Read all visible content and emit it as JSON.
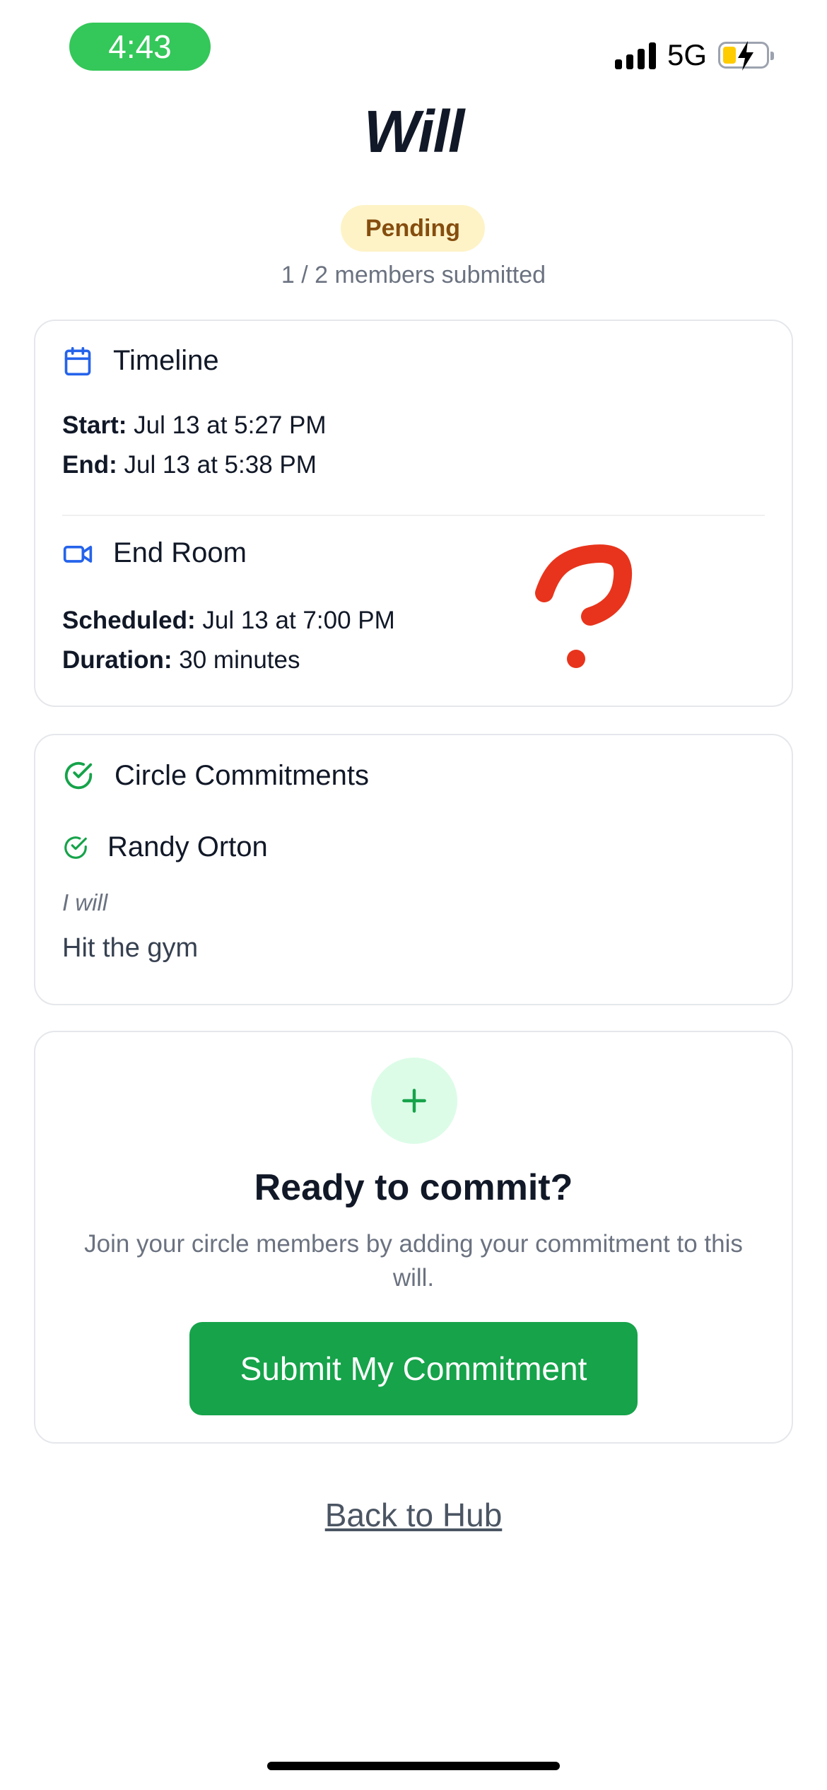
{
  "status_bar": {
    "time": "4:43",
    "network": "5G"
  },
  "page": {
    "title": "Will",
    "status_badge": "Pending",
    "members_submitted": "1 / 2 members submitted"
  },
  "timeline": {
    "heading": "Timeline",
    "start_label": "Start:",
    "start_value": "Jul 13 at 5:27 PM",
    "end_label": "End:",
    "end_value": "Jul 13 at 5:38 PM"
  },
  "end_room": {
    "heading": "End Room",
    "scheduled_label": "Scheduled:",
    "scheduled_value": "Jul 13 at 7:00 PM",
    "duration_label": "Duration:",
    "duration_value": "30 minutes"
  },
  "commitments": {
    "heading": "Circle Commitments",
    "items": [
      {
        "member": "Randy Orton",
        "prefix": "I will",
        "text": "Hit the gym"
      }
    ]
  },
  "cta": {
    "heading": "Ready to commit?",
    "description": "Join your circle members by adding your commitment to this will.",
    "button_label": "Submit My Commitment"
  },
  "footer": {
    "back_link": "Back to Hub"
  },
  "colors": {
    "accent_green": "#16a34a",
    "pending_bg": "#fef3c7",
    "pending_text": "#854d0e",
    "icon_blue": "#2563eb",
    "annotation_red": "#e8341c"
  },
  "icons": {
    "timeline": "calendar-icon",
    "end_room": "video-camera-icon",
    "commitments": "check-circle-icon",
    "cta": "plus-icon"
  }
}
